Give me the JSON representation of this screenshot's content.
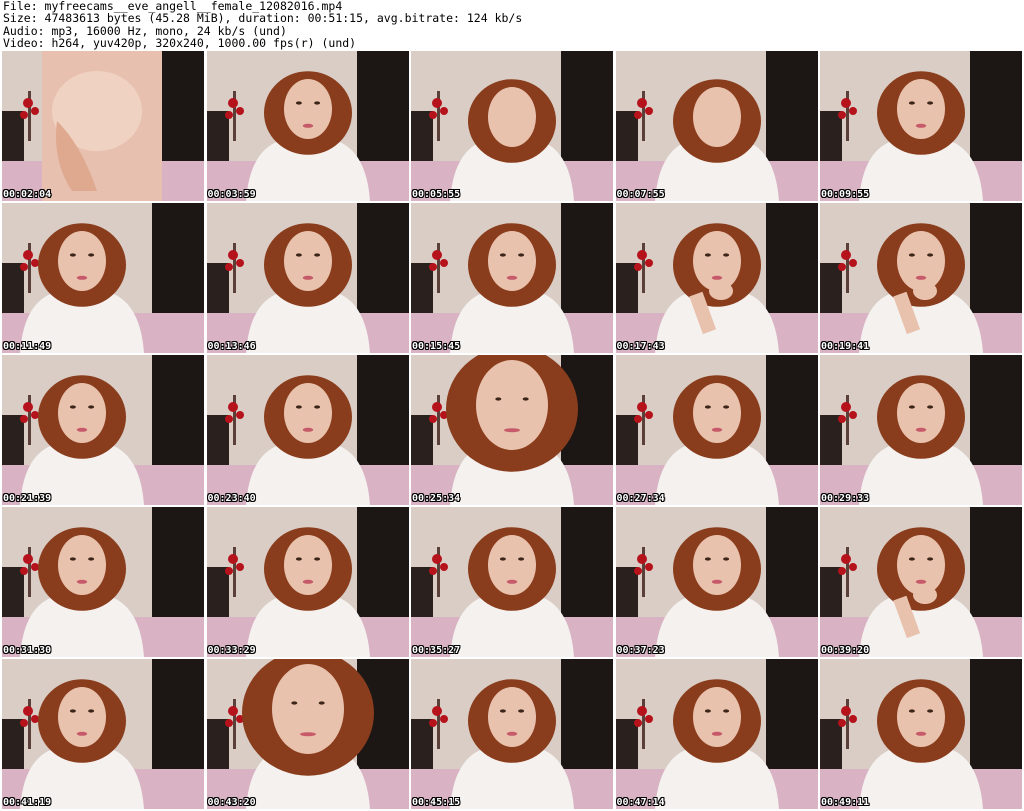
{
  "header": {
    "file": "File: myfreecams__eve_angell__female_12082016.mp4",
    "size": "Size: 47483613 bytes (45.28 MiB), duration: 00:51:15, avg.bitrate: 124 kb/s",
    "audio": "Audio: mp3, 16000 Hz, mono, 24 kb/s (und)",
    "video": "Video: h264, yuv420p, 320x240, 1000.00 fps(r) (und)"
  },
  "thumbnails": [
    {
      "timestamp": "00:02:04",
      "pose": "closeup-body"
    },
    {
      "timestamp": "00:03:59",
      "pose": "center"
    },
    {
      "timestamp": "00:05:55",
      "pose": "look-down"
    },
    {
      "timestamp": "00:07:55",
      "pose": "look-down"
    },
    {
      "timestamp": "00:09:55",
      "pose": "center"
    },
    {
      "timestamp": "00:11:49",
      "pose": "left"
    },
    {
      "timestamp": "00:13:46",
      "pose": "center"
    },
    {
      "timestamp": "00:15:45",
      "pose": "center"
    },
    {
      "timestamp": "00:17:43",
      "pose": "hand-chin"
    },
    {
      "timestamp": "00:19:41",
      "pose": "hands-up"
    },
    {
      "timestamp": "00:21:39",
      "pose": "left"
    },
    {
      "timestamp": "00:23:40",
      "pose": "center"
    },
    {
      "timestamp": "00:25:34",
      "pose": "closeup"
    },
    {
      "timestamp": "00:27:34",
      "pose": "center"
    },
    {
      "timestamp": "00:29:33",
      "pose": "center"
    },
    {
      "timestamp": "00:31:30",
      "pose": "left"
    },
    {
      "timestamp": "00:33:29",
      "pose": "center"
    },
    {
      "timestamp": "00:35:27",
      "pose": "center"
    },
    {
      "timestamp": "00:37:23",
      "pose": "center"
    },
    {
      "timestamp": "00:39:20",
      "pose": "hand-chin"
    },
    {
      "timestamp": "00:41:19",
      "pose": "left"
    },
    {
      "timestamp": "00:43:20",
      "pose": "closeup"
    },
    {
      "timestamp": "00:45:15",
      "pose": "center"
    },
    {
      "timestamp": "00:47:14",
      "pose": "center"
    },
    {
      "timestamp": "00:49:11",
      "pose": "center"
    }
  ],
  "colors": {
    "wall": "#d9cdc6",
    "door": "#1c1614",
    "bed": "#d9b3c4",
    "hair": "#8a3d1c",
    "skin": "#e9c2ad",
    "shirt": "#f4f1ef",
    "flower": "#b5121b"
  }
}
